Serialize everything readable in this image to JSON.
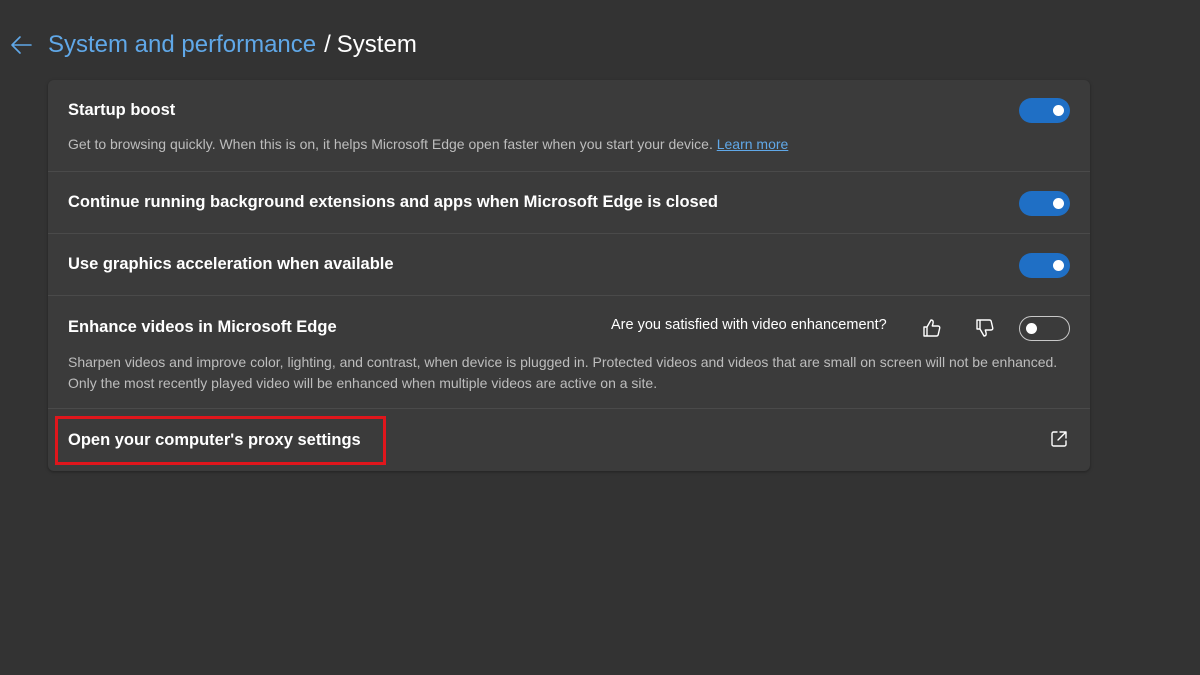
{
  "breadcrumb": {
    "parent": "System and performance",
    "separator": "/",
    "current": "System"
  },
  "settings": {
    "startup_boost": {
      "title": "Startup boost",
      "description": "Get to browsing quickly. When this is on, it helps Microsoft Edge open faster when you start your device.",
      "link": "Learn more",
      "enabled": true
    },
    "background_extensions": {
      "title": "Continue running background extensions and apps when Microsoft Edge is closed",
      "enabled": true
    },
    "graphics_acceleration": {
      "title": "Use graphics acceleration when available",
      "enabled": true
    },
    "enhance_videos": {
      "title": "Enhance videos in Microsoft Edge",
      "feedback_question": "Are you satisfied with video enhancement?",
      "description": "Sharpen videos and improve color, lighting, and contrast, when device is plugged in. Protected videos and videos that are small on screen will not be enhanced. Only the most recently played video will be enhanced when multiple videos are active on a site.",
      "enabled": false
    },
    "proxy": {
      "title": "Open your computer's proxy settings"
    }
  },
  "colors": {
    "background": "#333333",
    "card": "#3b3b3b",
    "accent": "#1f6fc5",
    "link": "#60a8e8",
    "highlight": "#e0161c"
  },
  "icons": {
    "back": "arrow-left-icon",
    "thumbs_up": "thumbs-up-icon",
    "thumbs_down": "thumbs-down-icon",
    "external": "external-link-icon"
  }
}
